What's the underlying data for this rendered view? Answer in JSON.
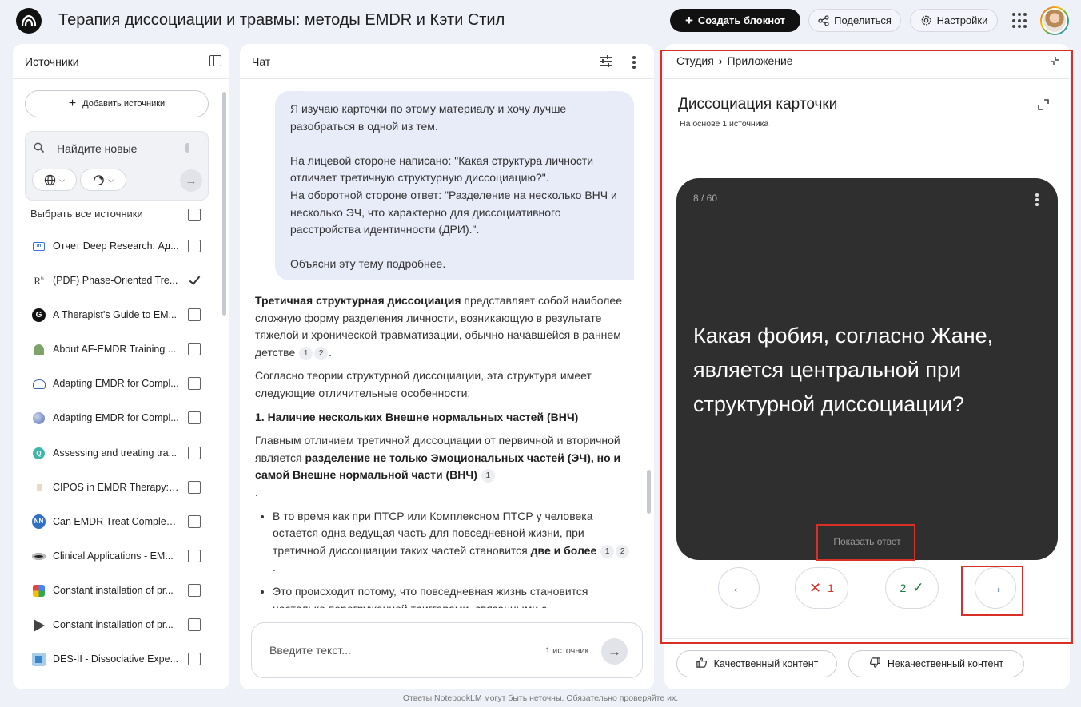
{
  "app": {
    "title": "Терапия диссоциации и травмы: методы EMDR и Кэти Стил",
    "create_label": "Создать блокнот",
    "share_label": "Поделиться",
    "settings_label": "Настройки"
  },
  "sources": {
    "title": "Источники",
    "add_label": "Добавить источники",
    "search_placeholder": "Найдите новые",
    "select_all_label": "Выбрать все источники",
    "items": [
      {
        "label": "Отчет Deep Research: Ад...",
        "icon": "doc-report-icon",
        "checked": false
      },
      {
        "label": "(PDF) Phase-Oriented Tre...",
        "icon": "researchgate-icon",
        "checked": true
      },
      {
        "label": "A Therapist's Guide to EM...",
        "icon": "site-g-icon",
        "checked": false
      },
      {
        "label": "About AF-EMDR Training ...",
        "icon": "tree-icon",
        "checked": false
      },
      {
        "label": "Adapting EMDR for Compl...",
        "icon": "emblem-icon",
        "checked": false
      },
      {
        "label": "Adapting EMDR for Compl...",
        "icon": "globe-site-icon",
        "checked": false
      },
      {
        "label": "Assessing and treating tra...",
        "icon": "circle-logo-icon",
        "checked": false
      },
      {
        "label": "CIPOS in EMDR Therapy: ...",
        "icon": "dot-logo-icon",
        "checked": false
      },
      {
        "label": "Can EMDR Treat Complex ...",
        "icon": "nn-logo-icon",
        "checked": false
      },
      {
        "label": "Clinical Applications - EM...",
        "icon": "eye-logo-icon",
        "checked": false
      },
      {
        "label": "Constant installation of pr...",
        "icon": "puzzle-icon",
        "checked": false
      },
      {
        "label": "Constant installation of pr...",
        "icon": "arrow-tag-icon",
        "checked": false
      },
      {
        "label": "DES-II - Dissociative Expe...",
        "icon": "square-logo-icon",
        "checked": false
      }
    ]
  },
  "chat": {
    "title": "Чат",
    "user_message": [
      "Я изучаю карточки по этому материалу и хочу лучше разобраться в одной из тем.",
      "",
      "На лицевой стороне написано: \"Какая структура личности отличает третичную структурную диссоциацию?\".",
      "На оборотной стороне ответ: \"Разделение на несколько ВНЧ и несколько ЭЧ, что характерно для диссоциативного расстройства идентичности (ДРИ).\".",
      "",
      "Объясни эту тему подробнее."
    ],
    "answer": {
      "p1_bold": "Третичная структурная диссоциация",
      "p1_rest": " представляет собой наиболее сложную форму разделения личности, возникающую в результате тяжелой и хронической травматизации, обычно начавшейся в раннем детстве",
      "p2": "Согласно теории структурной диссоциации, эта структура имеет следующие отличительные особенности:",
      "h1": "1. Наличие нескольких Внешне нормальных частей (ВНЧ)",
      "p3_a": "Главным отличием третичной диссоциации от первичной и вторичной является ",
      "p3_bold": "разделение не только Эмоциональных частей (ЭЧ), но и самой Внешне нормальной части (ВНЧ)",
      "b1_a": "В то время как при ПТСР или Комплексном ПТСР у человека остается одна ведущая часть для повседневной жизни, при третичной диссоциации таких частей становится ",
      "b1_bold": "две и более",
      "b2": "Это происходит потому, что повседневная жизнь становится настолько перегруженной триггерами, связанными с",
      "cite1": "1",
      "cite2": "2",
      "dot": "."
    },
    "input_placeholder": "Введите текст...",
    "source_count": "1 источник"
  },
  "studio": {
    "crumb_root": "Студия",
    "crumb_current": "Приложение",
    "title": "Диссоциация карточки",
    "subtitle": "На основе 1 источника",
    "card": {
      "counter": "8 / 60",
      "question": "Какая фобия, согласно Жане, является центральной при структурной диссоциации?",
      "show_answer": "Показать ответ"
    },
    "wrong_count": "1",
    "right_count": "2",
    "feedback_good": "Качественный контент",
    "feedback_bad": "Некачественный контент"
  },
  "footer": "Ответы NotebookLM могут быть неточны. Обязательно проверяйте их.",
  "colors": {
    "highlight": "#d93025",
    "card": "#2f2f2f",
    "accent": "#3b5fd9"
  }
}
